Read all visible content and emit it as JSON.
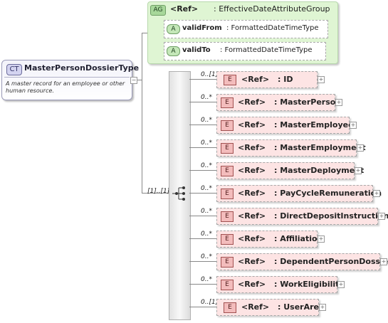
{
  "complex_type": {
    "badge": "CT",
    "name": "MasterPersonDossierType",
    "documentation": "A master record for an employee or other human resource."
  },
  "attribute_group": {
    "badge": "AG",
    "ref": "<Ref>",
    "name": ": EffectiveDateAttributeGroup",
    "attributes": [
      {
        "badge": "A",
        "name": "validFrom",
        "type": ": FormattedDateTimeType"
      },
      {
        "badge": "A",
        "name": "validTo",
        "type": ": FormattedDateTimeType"
      }
    ]
  },
  "sequence": {
    "cardinality": "[1]..[1]"
  },
  "elements": [
    {
      "card": "0..[1]",
      "badge": "E",
      "ref": "<Ref>",
      "name": ": ID",
      "expandable": true
    },
    {
      "card": "0..*",
      "badge": "E",
      "ref": "<Ref>",
      "name": ": MasterPerson",
      "expandable": true
    },
    {
      "card": "0..*",
      "badge": "E",
      "ref": "<Ref>",
      "name": ": MasterEmployee",
      "expandable": true
    },
    {
      "card": "0..*",
      "badge": "E",
      "ref": "<Ref>",
      "name": ": MasterEmployment",
      "expandable": true
    },
    {
      "card": "0..*",
      "badge": "E",
      "ref": "<Ref>",
      "name": ": MasterDeployment",
      "expandable": true
    },
    {
      "card": "0..*",
      "badge": "E",
      "ref": "<Ref>",
      "name": ": PayCycleRemuneration",
      "expandable": true
    },
    {
      "card": "0..*",
      "badge": "E",
      "ref": "<Ref>",
      "name": ": DirectDepositInstruction",
      "expandable": true
    },
    {
      "card": "0..*",
      "badge": "E",
      "ref": "<Ref>",
      "name": ": Affiliation",
      "expandable": true
    },
    {
      "card": "0..*",
      "badge": "E",
      "ref": "<Ref>",
      "name": ": DependentPersonDossier",
      "expandable": true
    },
    {
      "card": "0..*",
      "badge": "E",
      "ref": "<Ref>",
      "name": ": WorkEligibility",
      "expandable": true
    },
    {
      "card": "0..[1]",
      "badge": "E",
      "ref": "<Ref>",
      "name": ": UserArea",
      "expandable": true
    }
  ],
  "colors": {
    "complex_type_fill": "#d3d3f0",
    "attribute_group_fill": "#dff5d3",
    "element_fill": "#fde4e4"
  }
}
